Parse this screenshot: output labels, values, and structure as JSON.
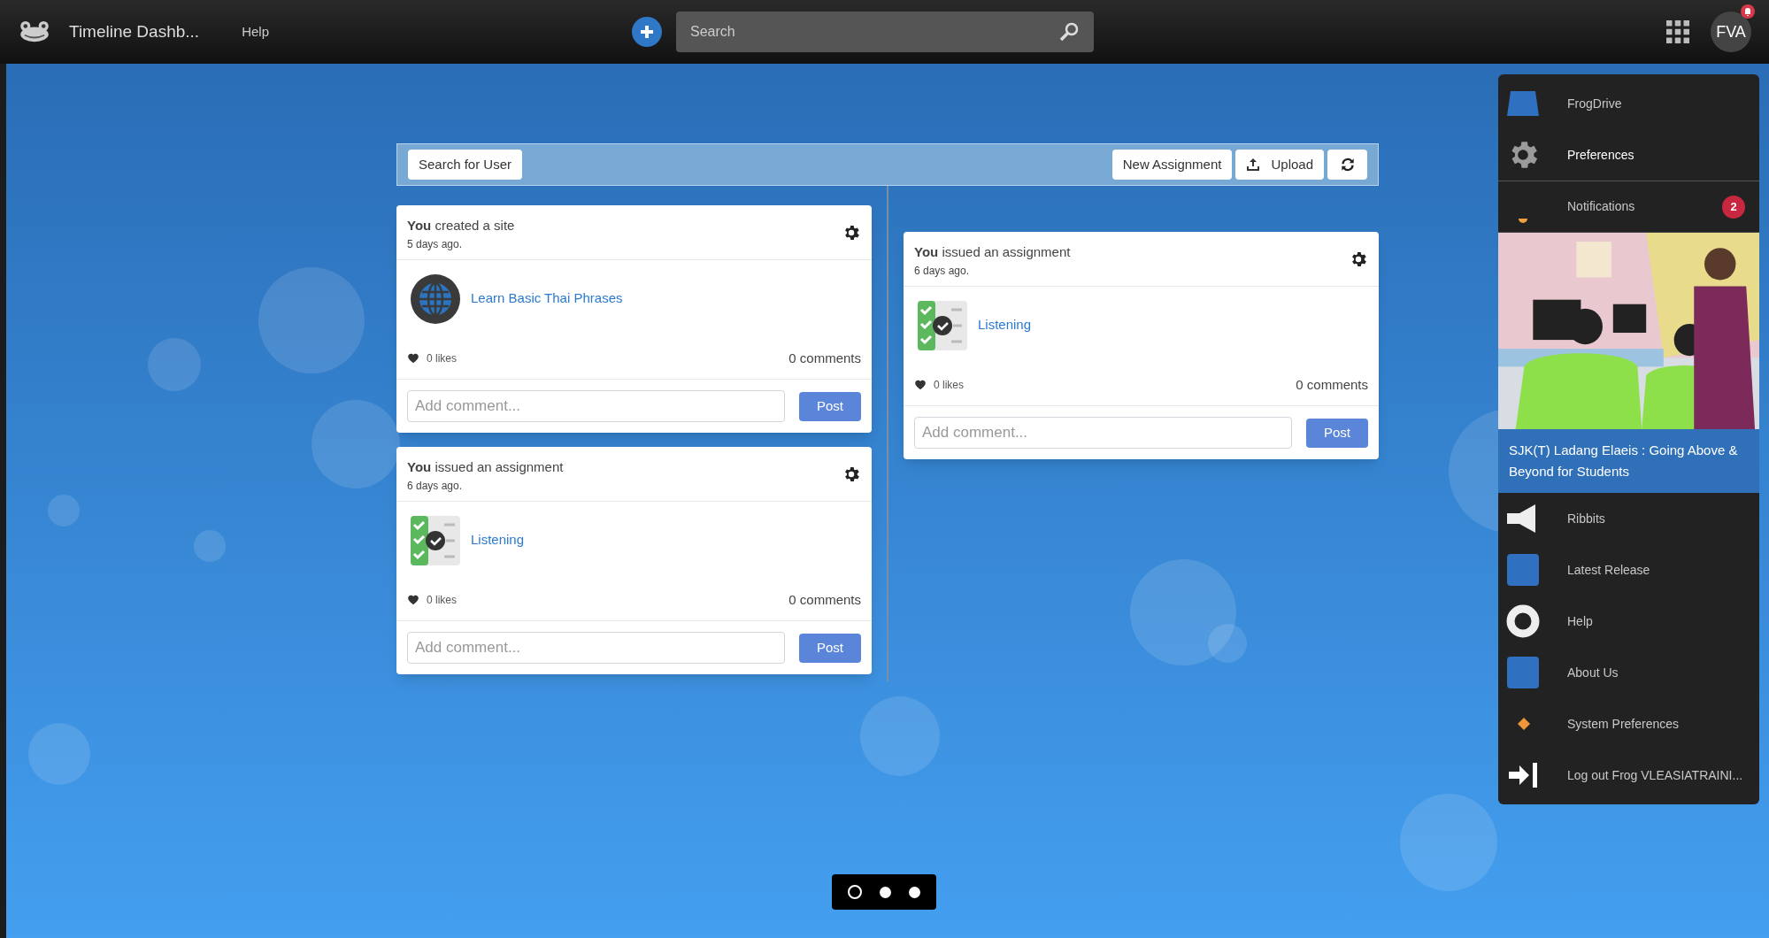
{
  "topbar": {
    "title": "Timeline Dashb...",
    "help": "Help",
    "search": {
      "placeholder": "Search"
    },
    "avatar": "FVA",
    "bell_alert": true
  },
  "toolbar": {
    "search_user": "Search for User",
    "new_assignment": "New Assignment",
    "upload": "Upload"
  },
  "columns": [
    {
      "cards": [
        {
          "kind": "site",
          "actor": "**You** created a site",
          "time": "5 days ago.",
          "link": "Learn Basic Thai Phrases",
          "likes": "0 likes",
          "comments": "0 comments",
          "comment_placeholder": "Add comment...",
          "post": "Post"
        },
        {
          "kind": "assignment",
          "actor": "**You** issued an assignment",
          "time": "6 days ago.",
          "link": "Listening",
          "likes": "0 likes",
          "comments": "0 comments",
          "comment_placeholder": "Add comment...",
          "post": "Post"
        }
      ]
    },
    {
      "cards": [
        {
          "kind": "assignment",
          "actor": "**You** issued an assignment",
          "time": "6 days ago.",
          "link": "Listening",
          "likes": "0 likes",
          "comments": "0 comments",
          "comment_placeholder": "Add comment...",
          "post": "Post"
        }
      ]
    }
  ],
  "menu": {
    "items": [
      {
        "kind": "drive",
        "label": "FrogDrive",
        "selected": false
      },
      {
        "kind": "gear",
        "label": "Preferences",
        "selected": true
      },
      {
        "kind": "notifications",
        "label": "Notifications",
        "selected": false,
        "badge": "2"
      },
      {
        "kind": "news",
        "label": "SJK(T) Ladang Elaeis : Going Above & Beyond for Students",
        "selected": false
      },
      {
        "kind": "megaphone",
        "label": "Ribbits",
        "selected": false
      },
      {
        "kind": "square",
        "label": "Latest Release",
        "selected": false
      },
      {
        "kind": "ring",
        "label": "Help",
        "selected": false
      },
      {
        "kind": "square",
        "label": "About Us",
        "selected": false
      },
      {
        "kind": "diamond",
        "label": "System Preferences",
        "selected": false
      },
      {
        "kind": "logout",
        "label": "Log out Frog VLEASIATRAINI...",
        "selected": false
      }
    ]
  },
  "pager": [
    {
      "selected": true
    },
    {
      "selected": false
    },
    {
      "selected": false
    }
  ]
}
